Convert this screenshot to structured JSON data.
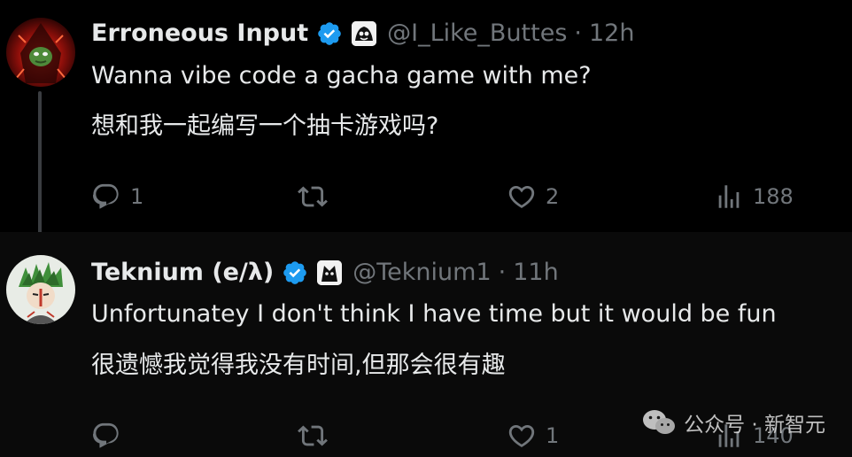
{
  "tweets": [
    {
      "display_name": "Erroneous Input",
      "handle": "@I_Like_Buttes",
      "separator": "·",
      "time": "12h",
      "text_en": "Wanna vibe code a gacha game with me?",
      "text_zh": "想和我一起编写一个抽卡游戏吗?",
      "replies": "1",
      "reposts": "",
      "likes": "2",
      "views": "188"
    },
    {
      "display_name": "Teknium (e/λ)",
      "handle": "@Teknium1",
      "separator": "·",
      "time": "11h",
      "text_en": "Unfortunatey I don't think I have time but it would be fun",
      "text_zh": "很遗憾我觉得我没有时间,但那会很有趣",
      "replies": "",
      "reposts": "",
      "likes": "1",
      "views": "140"
    }
  ],
  "watermark": {
    "text": "公众号 · 新智元"
  },
  "colors": {
    "background": "#000000",
    "text": "#e7e9ea",
    "muted": "#71767b",
    "verified": "#1d9bf0"
  },
  "icons": [
    "reply-icon",
    "repost-icon",
    "like-icon",
    "views-icon",
    "verified-badge-icon",
    "affiliate-badge-icon"
  ]
}
